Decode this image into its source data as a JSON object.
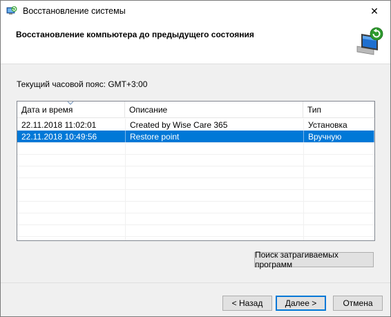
{
  "window": {
    "title": "Восстановление системы",
    "icon": "system-restore-icon",
    "close_glyph": "✕"
  },
  "header": {
    "title": "Восстановление компьютера до предыдущего состояния",
    "icon": "system-restore-monitor-icon"
  },
  "timezone_label": "Текущий часовой пояс: GMT+3:00",
  "table": {
    "columns": [
      "Дата и время",
      "Описание",
      "Тип"
    ],
    "sorted_column": "Дата и время",
    "rows": [
      {
        "date": "22.11.2018 11:02:01",
        "description": "Created by Wise Care 365",
        "type": "Установка",
        "selected": false
      },
      {
        "date": "22.11.2018 10:49:56",
        "description": "Restore point",
        "type": "Вручную",
        "selected": true
      }
    ]
  },
  "buttons": {
    "find_affected": "Поиск затрагиваемых программ",
    "back": "< Назад",
    "next": "Далее >",
    "cancel": "Отмена"
  },
  "colors": {
    "selection": "#0078d7",
    "background": "#f0f0f0",
    "header_bg": "#ffffff"
  }
}
